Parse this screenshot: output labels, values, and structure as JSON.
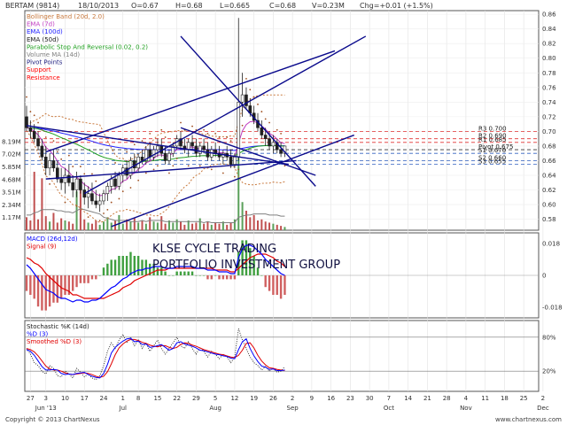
{
  "header": {
    "symbol": "BERTAM (9814)",
    "date": "18/10/2013",
    "open": "O=0.67",
    "high": "H=0.68",
    "low": "L=0.665",
    "close": "C=0.68",
    "volume": "V=0.23M",
    "change": "Chg=+0.01 (+1.5%)"
  },
  "footer": {
    "copyright": "Copyright © 2013 ChartNexus",
    "brand": "www.chartnexus.com"
  },
  "watermark": {
    "line1": "KLSE CYCLE TRADING",
    "line2": "PORTFOLIO INVESTMENT GROUP"
  },
  "colors": {
    "bollinger": "#c8783c",
    "ema7": "#c03cc0",
    "ema100": "#2020ff",
    "ema50": "#20a020",
    "psar": "#a05020",
    "volume_ma": "#808080",
    "pivot": "#202080",
    "support": "#ff0000",
    "resistance": "#ff0000",
    "trendline": "#0a0a8c",
    "macd": "#0000ff",
    "signal": "#e00000",
    "stoch_k": "#0000ff",
    "stoch_d": "#e00000"
  },
  "chart_data": [
    {
      "type": "candlestick",
      "panel": "price",
      "legend": [
        {
          "label": "Bollinger Band (20d, 2.0)",
          "color": "#c8783c"
        },
        {
          "label": "EMA (7d)",
          "color": "#c03cc0"
        },
        {
          "label": "EMA (100d)",
          "color": "#2020ff"
        },
        {
          "label": "EMA (50d)",
          "color": "#202020"
        },
        {
          "label": "Parabolic Stop And Reversal (0.02, 0.2)",
          "color": "#20a020"
        },
        {
          "label": "Volume MA (14d)",
          "color": "#808080"
        },
        {
          "label": "Pivot Points",
          "color": "#202080"
        },
        {
          "label": "Support",
          "color": "#ff0000"
        },
        {
          "label": "Resistance",
          "color": "#ff0000"
        }
      ],
      "y_ticks": [
        "0.86",
        "0.84",
        "0.82",
        "0.80",
        "0.78",
        "0.76",
        "0.74",
        "0.72",
        "0.70",
        "0.68",
        "0.66",
        "0.64",
        "0.62",
        "0.60",
        "0.58"
      ],
      "ylim": [
        0.565,
        0.865
      ],
      "volume_ticks": [
        "8.19M",
        "7.02M",
        "5.85M",
        "4.68M",
        "3.51M",
        "2.34M",
        "1.17M"
      ],
      "volume_max": 9.0,
      "pivot_levels": [
        {
          "label": "R3 0.700",
          "value": 0.7
        },
        {
          "label": "R2 0.690",
          "value": 0.69
        },
        {
          "label": "R1 0.685",
          "value": 0.685
        },
        {
          "label": "Pivot 0.675",
          "value": 0.675
        },
        {
          "label": "S1 0.670",
          "value": 0.67
        },
        {
          "label": "S2 0.660",
          "value": 0.66
        },
        {
          "label": "S3 0.655",
          "value": 0.655
        }
      ],
      "candles": [
        [
          0.72,
          0.735,
          0.7,
          0.705
        ],
        [
          0.705,
          0.715,
          0.69,
          0.7
        ],
        [
          0.7,
          0.71,
          0.685,
          0.69
        ],
        [
          0.69,
          0.7,
          0.675,
          0.68
        ],
        [
          0.68,
          0.69,
          0.66,
          0.665
        ],
        [
          0.665,
          0.68,
          0.64,
          0.65
        ],
        [
          0.65,
          0.67,
          0.64,
          0.66
        ],
        [
          0.66,
          0.675,
          0.645,
          0.65
        ],
        [
          0.65,
          0.66,
          0.63,
          0.635
        ],
        [
          0.635,
          0.65,
          0.62,
          0.63
        ],
        [
          0.63,
          0.65,
          0.615,
          0.64
        ],
        [
          0.64,
          0.655,
          0.625,
          0.63
        ],
        [
          0.63,
          0.64,
          0.61,
          0.62
        ],
        [
          0.62,
          0.645,
          0.61,
          0.635
        ],
        [
          0.635,
          0.64,
          0.615,
          0.62
        ],
        [
          0.62,
          0.63,
          0.6,
          0.61
        ],
        [
          0.61,
          0.625,
          0.595,
          0.615
        ],
        [
          0.615,
          0.63,
          0.6,
          0.605
        ],
        [
          0.605,
          0.62,
          0.595,
          0.6
        ],
        [
          0.6,
          0.615,
          0.59,
          0.605
        ],
        [
          0.605,
          0.62,
          0.6,
          0.615
        ],
        [
          0.615,
          0.63,
          0.605,
          0.625
        ],
        [
          0.625,
          0.64,
          0.615,
          0.635
        ],
        [
          0.635,
          0.645,
          0.62,
          0.625
        ],
        [
          0.625,
          0.645,
          0.62,
          0.64
        ],
        [
          0.64,
          0.655,
          0.63,
          0.65
        ],
        [
          0.65,
          0.66,
          0.635,
          0.64
        ],
        [
          0.64,
          0.665,
          0.635,
          0.66
        ],
        [
          0.66,
          0.67,
          0.645,
          0.65
        ],
        [
          0.65,
          0.67,
          0.645,
          0.665
        ],
        [
          0.665,
          0.675,
          0.655,
          0.66
        ],
        [
          0.66,
          0.68,
          0.655,
          0.675
        ],
        [
          0.675,
          0.685,
          0.66,
          0.665
        ],
        [
          0.665,
          0.68,
          0.66,
          0.675
        ],
        [
          0.675,
          0.69,
          0.665,
          0.68
        ],
        [
          0.68,
          0.69,
          0.665,
          0.67
        ],
        [
          0.67,
          0.68,
          0.655,
          0.66
        ],
        [
          0.66,
          0.675,
          0.655,
          0.67
        ],
        [
          0.67,
          0.685,
          0.665,
          0.68
        ],
        [
          0.68,
          0.695,
          0.675,
          0.69
        ],
        [
          0.69,
          0.7,
          0.675,
          0.68
        ],
        [
          0.68,
          0.69,
          0.67,
          0.675
        ],
        [
          0.675,
          0.69,
          0.665,
          0.685
        ],
        [
          0.685,
          0.695,
          0.675,
          0.68
        ],
        [
          0.68,
          0.69,
          0.665,
          0.67
        ],
        [
          0.67,
          0.685,
          0.665,
          0.68
        ],
        [
          0.68,
          0.69,
          0.67,
          0.675
        ],
        [
          0.675,
          0.685,
          0.66,
          0.665
        ],
        [
          0.665,
          0.68,
          0.66,
          0.675
        ],
        [
          0.675,
          0.685,
          0.665,
          0.67
        ],
        [
          0.67,
          0.68,
          0.66,
          0.665
        ],
        [
          0.665,
          0.675,
          0.655,
          0.67
        ],
        [
          0.67,
          0.68,
          0.66,
          0.665
        ],
        [
          0.665,
          0.675,
          0.65,
          0.655
        ],
        [
          0.655,
          0.67,
          0.65,
          0.665
        ],
        [
          0.665,
          0.855,
          0.66,
          0.74
        ],
        [
          0.74,
          0.78,
          0.72,
          0.75
        ],
        [
          0.75,
          0.76,
          0.73,
          0.735
        ],
        [
          0.735,
          0.745,
          0.72,
          0.725
        ],
        [
          0.725,
          0.735,
          0.71,
          0.715
        ],
        [
          0.715,
          0.725,
          0.7,
          0.705
        ],
        [
          0.705,
          0.715,
          0.69,
          0.695
        ],
        [
          0.695,
          0.705,
          0.68,
          0.69
        ],
        [
          0.69,
          0.7,
          0.675,
          0.68
        ],
        [
          0.68,
          0.695,
          0.67,
          0.685
        ],
        [
          0.685,
          0.69,
          0.67,
          0.675
        ],
        [
          0.675,
          0.685,
          0.665,
          0.67
        ],
        [
          0.67,
          0.68,
          0.665,
          0.68
        ]
      ],
      "volumes": [
        1.2,
        0.9,
        5.4,
        1.0,
        4.8,
        1.3,
        0.8,
        1.6,
        0.7,
        1.1,
        0.9,
        0.8,
        0.6,
        3.6,
        4.1,
        1.0,
        0.7,
        0.6,
        0.9,
        0.5,
        0.8,
        1.2,
        0.7,
        0.9,
        1.4,
        0.6,
        1.0,
        0.8,
        1.1,
        0.7,
        0.9,
        0.6,
        1.2,
        0.8,
        0.7,
        1.3,
        0.6,
        0.9,
        0.7,
        1.0,
        0.8,
        0.5,
        0.9,
        0.6,
        0.7,
        1.1,
        0.6,
        0.8,
        0.5,
        0.7,
        0.6,
        0.8,
        0.5,
        0.7,
        1.0,
        8.8,
        2.6,
        1.8,
        1.2,
        1.4,
        0.9,
        1.0,
        0.8,
        0.7,
        0.6,
        0.5,
        0.4,
        0.3
      ],
      "volume_ma": [
        1.4,
        1.4,
        1.6,
        1.7,
        1.9,
        1.9,
        1.9,
        1.9,
        1.8,
        1.8,
        1.7,
        1.7,
        1.6,
        1.8,
        2.0,
        1.9,
        1.8,
        1.7,
        1.6,
        1.5,
        1.2,
        1.1,
        1.0,
        0.9,
        0.9,
        0.9,
        0.9,
        0.8,
        0.8,
        0.8,
        0.9,
        0.8,
        0.9,
        0.9,
        0.9,
        0.9,
        0.8,
        0.8,
        0.8,
        0.8,
        0.8,
        0.8,
        0.8,
        0.8,
        0.8,
        0.8,
        0.7,
        0.8,
        0.7,
        0.7,
        0.7,
        0.7,
        0.7,
        0.7,
        0.7,
        1.2,
        1.3,
        1.4,
        1.4,
        1.5,
        1.5,
        1.5,
        1.5,
        1.4,
        1.4,
        1.4,
        1.3,
        1.3
      ],
      "trendlines": [
        {
          "from": [
            0,
            0.708
          ],
          "to": [
            68,
            0.655
          ]
        },
        {
          "from": [
            22,
            0.57
          ],
          "to": [
            85,
            0.695
          ]
        },
        {
          "from": [
            5,
            0.672
          ],
          "to": [
            80,
            0.81
          ]
        },
        {
          "from": [
            15,
            0.615
          ],
          "to": [
            88,
            0.83
          ]
        },
        {
          "from": [
            40,
            0.705
          ],
          "to": [
            75,
            0.64
          ]
        },
        {
          "from": [
            40,
            0.83
          ],
          "to": [
            75,
            0.625
          ]
        },
        {
          "from": [
            5,
            0.635
          ],
          "to": [
            70,
            0.66
          ]
        }
      ]
    },
    {
      "type": "line",
      "panel": "macd",
      "legend": [
        {
          "label": "MACD (26d,12d)",
          "color": "#0000ff"
        },
        {
          "label": "Signal (9)",
          "color": "#e00000"
        }
      ],
      "y_ticks": [
        "0.018",
        "0",
        "-0.018"
      ],
      "ylim": [
        -0.024,
        0.024
      ],
      "macd": [
        0.006,
        0.004,
        0.001,
        -0.002,
        -0.005,
        -0.008,
        -0.009,
        -0.01,
        -0.012,
        -0.013,
        -0.013,
        -0.014,
        -0.015,
        -0.014,
        -0.014,
        -0.015,
        -0.015,
        -0.014,
        -0.014,
        -0.013,
        -0.011,
        -0.009,
        -0.007,
        -0.006,
        -0.004,
        -0.002,
        -0.001,
        0.001,
        0.002,
        0.003,
        0.003,
        0.004,
        0.004,
        0.005,
        0.005,
        0.005,
        0.004,
        0.004,
        0.004,
        0.005,
        0.005,
        0.005,
        0.005,
        0.005,
        0.004,
        0.004,
        0.004,
        0.003,
        0.003,
        0.003,
        0.002,
        0.002,
        0.002,
        0.001,
        0.001,
        0.01,
        0.015,
        0.017,
        0.017,
        0.016,
        0.014,
        0.012,
        0.009,
        0.007,
        0.005,
        0.003,
        0.001,
        0.0
      ],
      "signal": [
        0.01,
        0.009,
        0.007,
        0.006,
        0.004,
        0.001,
        -0.001,
        -0.003,
        -0.005,
        -0.007,
        -0.008,
        -0.009,
        -0.011,
        -0.011,
        -0.012,
        -0.013,
        -0.013,
        -0.013,
        -0.013,
        -0.013,
        -0.013,
        -0.012,
        -0.011,
        -0.01,
        -0.009,
        -0.007,
        -0.006,
        -0.005,
        -0.003,
        -0.002,
        -0.001,
        0.0,
        0.001,
        0.002,
        0.003,
        0.003,
        0.003,
        0.004,
        0.004,
        0.004,
        0.004,
        0.004,
        0.004,
        0.004,
        0.004,
        0.004,
        0.004,
        0.004,
        0.004,
        0.003,
        0.003,
        0.003,
        0.003,
        0.002,
        0.002,
        0.004,
        0.006,
        0.008,
        0.01,
        0.011,
        0.012,
        0.012,
        0.012,
        0.011,
        0.01,
        0.008,
        0.007,
        0.005
      ]
    },
    {
      "type": "line",
      "panel": "stochastic",
      "legend": [
        {
          "label": "Stochastic %K (14d)",
          "color": "#202020"
        },
        {
          "label": "%D (3)",
          "color": "#0000ff"
        },
        {
          "label": "Smoothed %D (3)",
          "color": "#e00000"
        }
      ],
      "y_ticks": [
        "80%",
        "20%"
      ],
      "ylim": [
        0,
        100
      ],
      "k": [
        60,
        50,
        35,
        30,
        20,
        15,
        30,
        25,
        12,
        10,
        20,
        15,
        8,
        25,
        18,
        10,
        15,
        8,
        5,
        12,
        30,
        55,
        70,
        60,
        75,
        85,
        70,
        80,
        65,
        75,
        60,
        70,
        55,
        65,
        75,
        60,
        50,
        60,
        70,
        80,
        65,
        60,
        72,
        60,
        50,
        62,
        55,
        45,
        55,
        50,
        42,
        50,
        45,
        35,
        45,
        95,
        75,
        60,
        45,
        35,
        30,
        22,
        28,
        20,
        25,
        18,
        20,
        28
      ],
      "d": [
        58,
        55,
        48,
        38,
        28,
        22,
        22,
        23,
        22,
        16,
        14,
        15,
        14,
        16,
        17,
        18,
        14,
        11,
        9,
        8,
        16,
        32,
        52,
        62,
        68,
        73,
        77,
        78,
        72,
        73,
        67,
        68,
        62,
        63,
        65,
        67,
        62,
        57,
        60,
        70,
        72,
        68,
        66,
        64,
        61,
        57,
        56,
        54,
        52,
        50,
        49,
        47,
        46,
        43,
        42,
        58,
        72,
        77,
        60,
        47,
        37,
        29,
        27,
        23,
        24,
        21,
        21,
        22
      ],
      "smoothed": [
        60,
        58,
        54,
        47,
        38,
        29,
        24,
        22,
        22,
        20,
        17,
        15,
        14,
        15,
        16,
        17,
        16,
        14,
        11,
        9,
        11,
        19,
        33,
        49,
        61,
        68,
        73,
        76,
        76,
        74,
        71,
        69,
        66,
        64,
        63,
        65,
        65,
        62,
        60,
        62,
        67,
        70,
        69,
        66,
        64,
        61,
        58,
        56,
        54,
        52,
        50,
        49,
        47,
        45,
        44,
        48,
        57,
        69,
        70,
        61,
        48,
        38,
        31,
        26,
        25,
        23,
        22,
        21
      ]
    }
  ],
  "x_axis": {
    "days": [
      {
        "label": "27",
        "i": 1
      },
      {
        "label": "3",
        "i": 5
      },
      {
        "label": "10",
        "i": 10
      },
      {
        "label": "17",
        "i": 15
      },
      {
        "label": "24",
        "i": 20
      },
      {
        "label": "1",
        "i": 25
      },
      {
        "label": "8",
        "i": 29
      },
      {
        "label": "15",
        "i": 34
      },
      {
        "label": "22",
        "i": 39
      },
      {
        "label": "29",
        "i": 44
      },
      {
        "label": "5",
        "i": 49
      },
      {
        "label": "12",
        "i": 54
      },
      {
        "label": "19",
        "i": 59
      },
      {
        "label": "26",
        "i": 64
      },
      {
        "label": "2",
        "i": 69
      },
      {
        "label": "9",
        "i": 74
      },
      {
        "label": "16",
        "i": 79
      },
      {
        "label": "23",
        "i": 84
      },
      {
        "label": "30",
        "i": 89
      },
      {
        "label": "7",
        "i": 94
      },
      {
        "label": "14",
        "i": 99
      },
      {
        "label": "21",
        "i": 104
      },
      {
        "label": "28",
        "i": 109
      },
      {
        "label": "4",
        "i": 114
      },
      {
        "label": "11",
        "i": 119
      },
      {
        "label": "18",
        "i": 124
      },
      {
        "label": "25",
        "i": 129
      },
      {
        "label": "2",
        "i": 134
      }
    ],
    "months": [
      {
        "label": "Jun '13",
        "i": 5
      },
      {
        "label": "Jul",
        "i": 25
      },
      {
        "label": "Aug",
        "i": 49
      },
      {
        "label": "Sep",
        "i": 69
      },
      {
        "label": "Oct",
        "i": 94
      },
      {
        "label": "Nov",
        "i": 114
      },
      {
        "label": "Dec",
        "i": 134
      }
    ]
  }
}
